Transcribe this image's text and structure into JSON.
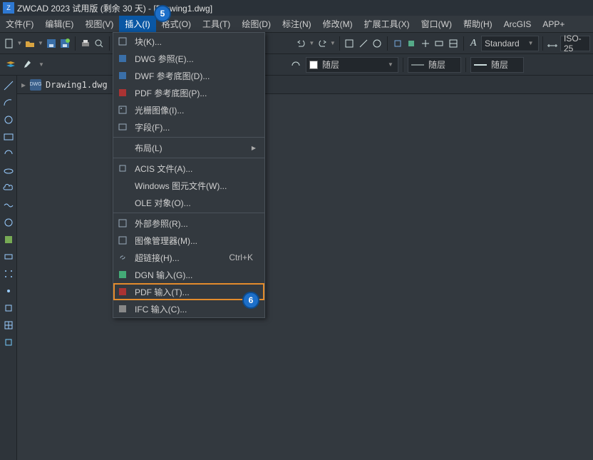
{
  "title": "ZWCAD 2023 试用版 (剩余 30 天) - [Drawing1.dwg]",
  "menubar": [
    {
      "label": "文件(F)"
    },
    {
      "label": "编辑(E)"
    },
    {
      "label": "视图(V)"
    },
    {
      "label": "插入(I)",
      "active": true
    },
    {
      "label": "格式(O)"
    },
    {
      "label": "工具(T)"
    },
    {
      "label": "绘图(D)"
    },
    {
      "label": "标注(N)"
    },
    {
      "label": "修改(M)"
    },
    {
      "label": "扩展工具(X)"
    },
    {
      "label": "窗口(W)"
    },
    {
      "label": "帮助(H)"
    },
    {
      "label": "ArcGIS"
    },
    {
      "label": "APP+"
    }
  ],
  "style_combo": "Standard",
  "iso_combo": "ISO-25",
  "layer_combo": "随层",
  "layer_combo2": "随层",
  "layer_combo3": "随层",
  "file_tab": "Drawing1.dwg",
  "dropdown": [
    {
      "type": "item",
      "label": "块(K)...",
      "icon": "block",
      "arrow": false
    },
    {
      "type": "item",
      "label": "DWG 参照(E)...",
      "icon": "dwg"
    },
    {
      "type": "item",
      "label": "DWF 参考底图(D)...",
      "icon": "dwf"
    },
    {
      "type": "item",
      "label": "PDF 参考底图(P)...",
      "icon": "pdf"
    },
    {
      "type": "item",
      "label": "光栅图像(I)...",
      "icon": "img"
    },
    {
      "type": "item",
      "label": "字段(F)...",
      "icon": "field"
    },
    {
      "type": "sep"
    },
    {
      "type": "item",
      "label": "布局(L)",
      "icon": "",
      "arrow": true
    },
    {
      "type": "sep"
    },
    {
      "type": "item",
      "label": "ACIS 文件(A)...",
      "icon": "acis"
    },
    {
      "type": "item",
      "label": "Windows 图元文件(W)...",
      "icon": ""
    },
    {
      "type": "item",
      "label": "OLE 对象(O)...",
      "icon": ""
    },
    {
      "type": "sep"
    },
    {
      "type": "item",
      "label": "外部参照(R)...",
      "icon": "xref"
    },
    {
      "type": "item",
      "label": "图像管理器(M)...",
      "icon": "imgmgr"
    },
    {
      "type": "item",
      "label": "超链接(H)...",
      "icon": "link",
      "shortcut": "Ctrl+K"
    },
    {
      "type": "item",
      "label": "DGN 输入(G)...",
      "icon": "dgn"
    },
    {
      "type": "item",
      "label": "PDF 输入(T)...",
      "icon": "pdfin",
      "highlight": true
    },
    {
      "type": "item",
      "label": "IFC 输入(C)...",
      "icon": "ifc"
    }
  ],
  "anno5": "5",
  "anno6": "6",
  "left_icons": [
    "line",
    "arc",
    "circle",
    "rect",
    "carc",
    "ellipse",
    "cloud",
    "wave",
    "oval",
    "fill",
    "rectf",
    "dots",
    "pt",
    "sq",
    "grid",
    "sqo"
  ]
}
